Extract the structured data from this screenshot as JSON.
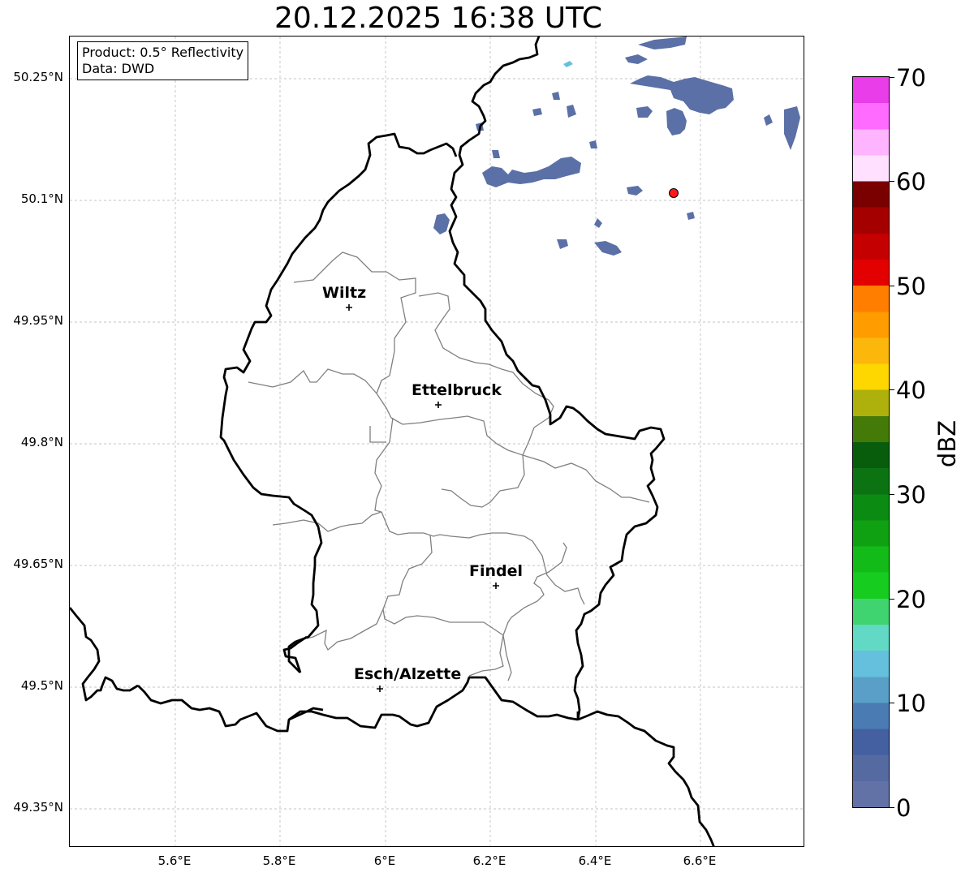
{
  "title": "20.12.2025 16:38 UTC",
  "info": {
    "product": "Product: 0.5° Reflectivity",
    "source": "Data: DWD"
  },
  "lat_labels": [
    "50.25°N",
    "50.1°N",
    "49.95°N",
    "49.8°N",
    "49.65°N",
    "49.5°N",
    "49.35°N"
  ],
  "lon_labels": [
    "5.6°E",
    "5.8°E",
    "6°E",
    "6.2°E",
    "6.4°E",
    "6.6°E"
  ],
  "colorbar": {
    "unit": "dBZ",
    "ticks": [
      "0",
      "10",
      "20",
      "30",
      "40",
      "50",
      "60",
      "70"
    ],
    "colors": [
      "#6272a6",
      "#556aa1",
      "#4460a0",
      "#4b7bb3",
      "#5a9fc8",
      "#64c0dd",
      "#62d9c5",
      "#3fd470",
      "#16cc1f",
      "#13bb19",
      "#10a112",
      "#0c8b12",
      "#0b7312",
      "#075d0c",
      "#447a07",
      "#aeb10b",
      "#ffd700",
      "#fcb70c",
      "#ff9c00",
      "#ff7e00",
      "#e20000",
      "#c40000",
      "#a50000",
      "#7a0000",
      "#ffe1ff",
      "#ffb4ff",
      "#ff6bff",
      "#e83de8"
    ]
  },
  "cities": [
    {
      "name": "Wiltz"
    },
    {
      "name": "Ettelbruck"
    },
    {
      "name": "Findel"
    },
    {
      "name": "Esch/Alzette"
    }
  ],
  "colors": {
    "border": "#000000",
    "canton": "#808080",
    "echo": "#5a70a6",
    "echo_light": "#64c0dd",
    "marker": "#ff1a1a",
    "grid": "#b0b0b0"
  }
}
